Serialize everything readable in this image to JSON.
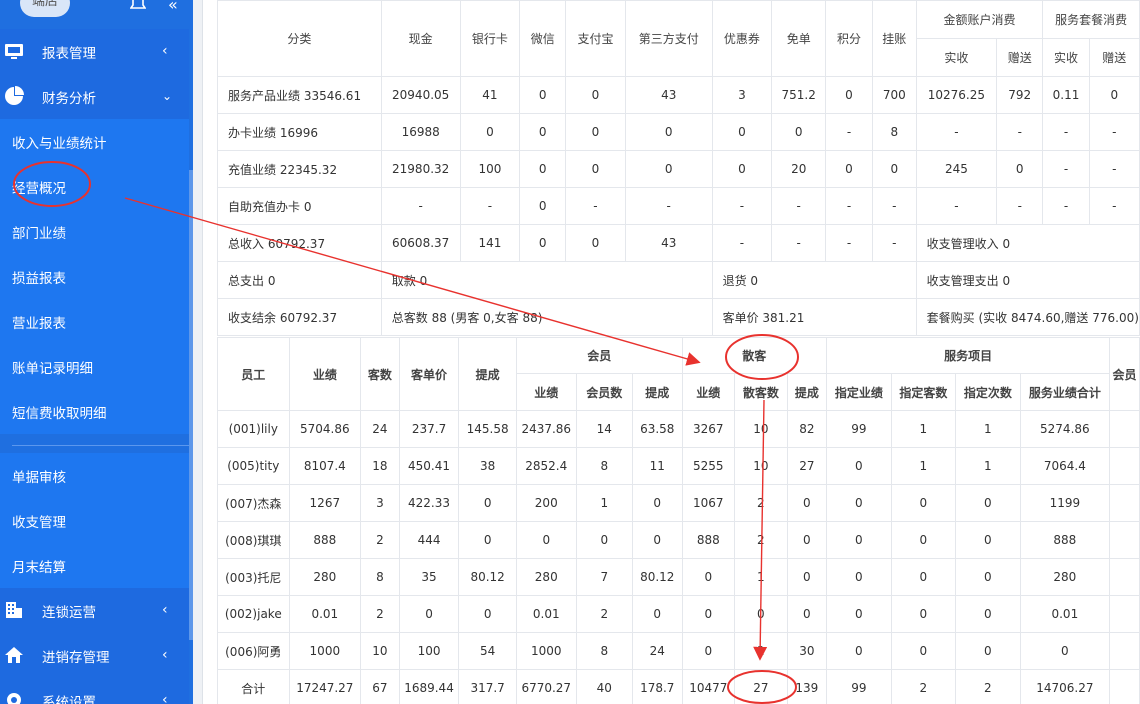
{
  "sidebar": {
    "brand": "端店",
    "sections": [
      {
        "label": "报表管理",
        "icon": "monitor-icon",
        "expanded": false
      },
      {
        "label": "财务分析",
        "icon": "pie-chart-icon",
        "expanded": true
      }
    ],
    "subitems": [
      "收入与业绩统计",
      "经营概况",
      "部门业绩",
      "损益报表",
      "营业报表",
      "账单记录明细",
      "短信费收取明细",
      "单据审核",
      "收支管理",
      "月末结算"
    ],
    "bottom_sections": [
      {
        "label": "连锁运营",
        "icon": "building-icon"
      },
      {
        "label": "进销存管理",
        "icon": "home-icon"
      },
      {
        "label": "系统设置",
        "icon": "gear-icon"
      }
    ]
  },
  "summary": {
    "headers": [
      "分类",
      "现金",
      "银行卡",
      "微信",
      "支付宝",
      "第三方支付",
      "优惠券",
      "免单",
      "积分",
      "挂账"
    ],
    "group_headers": [
      "金额账户消费",
      "服务套餐消费"
    ],
    "sub_headers": [
      "实收",
      "赠送",
      "实收",
      "赠送"
    ],
    "rows": [
      [
        "服务产品业绩 33546.61",
        "20940.05",
        "41",
        "0",
        "0",
        "43",
        "3",
        "751.2",
        "0",
        "700",
        "10276.25",
        "792",
        "0.11",
        "0"
      ],
      [
        "办卡业绩 16996",
        "16988",
        "0",
        "0",
        "0",
        "0",
        "0",
        "0",
        "-",
        "8",
        "-",
        "-",
        "-",
        "-"
      ],
      [
        "充值业绩 22345.32",
        "21980.32",
        "100",
        "0",
        "0",
        "0",
        "0",
        "20",
        "0",
        "0",
        "245",
        "0",
        "-",
        "-"
      ],
      [
        "自助充值办卡 0",
        "-",
        "-",
        "0",
        "-",
        "-",
        "-",
        "-",
        "-",
        "-",
        "-",
        "-",
        "-",
        "-"
      ],
      [
        "总收入 60792.37",
        "60608.37",
        "141",
        "0",
        "0",
        "43",
        "-",
        "-",
        "-",
        "-",
        "收支管理收入 0"
      ]
    ],
    "footer": [
      {
        "a": "总支出 0",
        "b": "取款 0",
        "c": "退货 0",
        "d": "收支管理支出 0"
      },
      {
        "a": "收支结余 60792.37",
        "b": "总客数 88 (男客 0,女客 88)",
        "c": "客单价 381.21",
        "d": "套餐购买 (实收 8474.60,赠送 776.00)"
      }
    ]
  },
  "staff": {
    "headers": [
      "员工",
      "业绩",
      "客数",
      "客单价",
      "提成"
    ],
    "groups": [
      "会员",
      "散客",
      "服务项目"
    ],
    "member_cols": [
      "业绩",
      "会员数",
      "提成"
    ],
    "walkin_cols": [
      "业绩",
      "散客数",
      "提成"
    ],
    "service_cols": [
      "指定业绩",
      "指定客数",
      "指定次数",
      "服务业绩合计",
      "会员"
    ],
    "rows": [
      [
        "(001)lily",
        "5704.86",
        "24",
        "237.7",
        "145.58",
        "2437.86",
        "14",
        "63.58",
        "3267",
        "10",
        "82",
        "99",
        "1",
        "1",
        "5274.86"
      ],
      [
        "(005)tity",
        "8107.4",
        "18",
        "450.41",
        "38",
        "2852.4",
        "8",
        "11",
        "5255",
        "10",
        "27",
        "0",
        "1",
        "1",
        "7064.4"
      ],
      [
        "(007)杰森",
        "1267",
        "3",
        "422.33",
        "0",
        "200",
        "1",
        "0",
        "1067",
        "2",
        "0",
        "0",
        "0",
        "0",
        "1199"
      ],
      [
        "(008)琪琪",
        "888",
        "2",
        "444",
        "0",
        "0",
        "0",
        "0",
        "888",
        "2",
        "0",
        "0",
        "0",
        "0",
        "888"
      ],
      [
        "(003)托尼",
        "280",
        "8",
        "35",
        "80.12",
        "280",
        "7",
        "80.12",
        "0",
        "1",
        "0",
        "0",
        "0",
        "0",
        "280"
      ],
      [
        "(002)jake",
        "0.01",
        "2",
        "0",
        "0",
        "0.01",
        "2",
        "0",
        "0",
        "0",
        "0",
        "0",
        "0",
        "0",
        "0.01"
      ],
      [
        "(006)阿勇",
        "1000",
        "10",
        "100",
        "54",
        "1000",
        "8",
        "24",
        "0",
        "2",
        "30",
        "0",
        "0",
        "0",
        "0"
      ],
      [
        "合计",
        "17247.27",
        "67",
        "1689.44",
        "317.7",
        "6770.27",
        "40",
        "178.7",
        "10477",
        "27",
        "139",
        "99",
        "2",
        "2",
        "14706.27"
      ]
    ]
  },
  "colors": {
    "sidebar": "#1f6fe0",
    "annotation": "#e8322e"
  }
}
